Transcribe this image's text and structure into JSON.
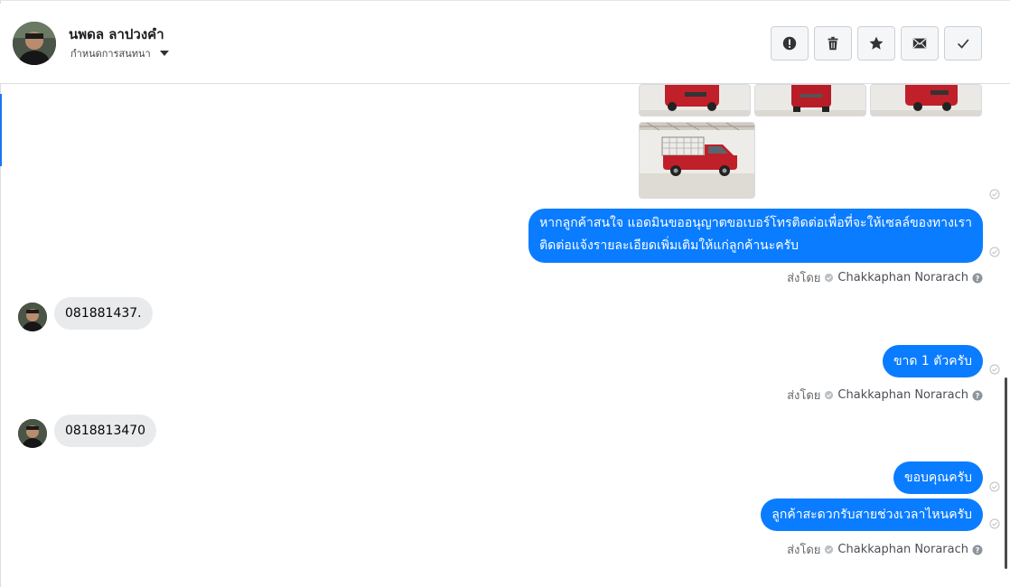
{
  "header": {
    "name": "นพดล ลาปวงคำ",
    "subtitle": "กำหนดการสนทนา",
    "actions": [
      {
        "icon": "exclamation-icon"
      },
      {
        "icon": "trash-icon"
      },
      {
        "icon": "star-icon"
      },
      {
        "icon": "envelope-icon"
      },
      {
        "icon": "checkmark-icon"
      }
    ]
  },
  "messages": {
    "out1_line1": "หากลูกค้าสนใจ แอดมินขออนุญาตขอเบอร์โทรติดต่อเพื่อที่จะให้เซลล์ของทางเรา",
    "out1_line2": "ติดต่อแจ้งรายละเอียดเพิ่มเติมให้แก่ลูกค้านะครับ",
    "in1": "081881437.",
    "out2": "ขาด 1 ตัวครับ",
    "in2": "0818813470",
    "out3": "ขอบคุณครับ",
    "out4": "ลูกค้าสะดวกรับสายช่วงเวลาไหนครับ"
  },
  "sent_by": {
    "label": "ส่งโดย",
    "agent": "Chakkaphan Norarach"
  },
  "colors": {
    "accent": "#0a7cff",
    "incoming": "#e9eaec",
    "car": "#c0202a"
  }
}
